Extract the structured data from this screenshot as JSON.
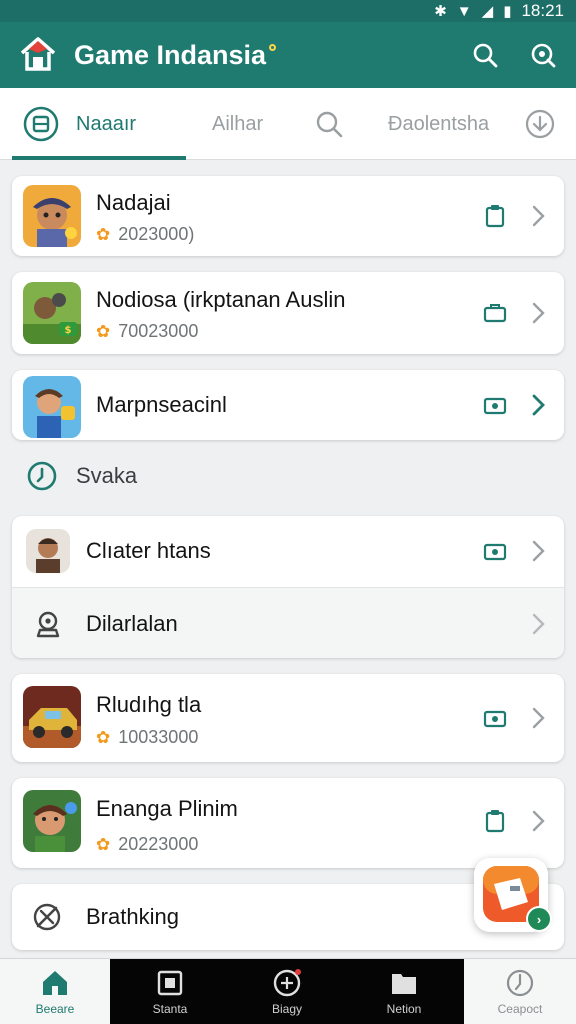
{
  "status_bar": {
    "time": "18:21",
    "icons": [
      "bluetooth-icon",
      "wifi-icon",
      "signal-icon",
      "battery-icon"
    ]
  },
  "app_bar": {
    "title": "Game Indansia",
    "actions": [
      "search-icon",
      "search-alt-icon"
    ]
  },
  "tabs": [
    {
      "label": "Naaaır",
      "icon": "grid-icon",
      "active": true
    },
    {
      "label": "Ailhar",
      "active": false
    },
    {
      "label": "",
      "icon": "search-icon",
      "active": false
    },
    {
      "label": "Ðaolentsha",
      "active": false
    },
    {
      "label": "",
      "icon": "download-icon",
      "active": false
    }
  ],
  "items": [
    {
      "name": "Nadajai",
      "meta": "2023000)"
    },
    {
      "name": "Nodiosa (irkptanan Auslin",
      "meta": "70023000"
    },
    {
      "name": "Marpnseacinl",
      "meta": ""
    }
  ],
  "section": {
    "label": "Svaka",
    "icon": "clock-icon"
  },
  "group": [
    {
      "name": "Clıater htans"
    },
    {
      "name": "Dilarlalan"
    }
  ],
  "items2": [
    {
      "name": "Rludıhg tla",
      "meta": "10033000"
    },
    {
      "name": "Enanga Plinim",
      "meta": "20223000"
    },
    {
      "name": "Brathking"
    }
  ],
  "bottom_nav": [
    {
      "label": "Beeare",
      "icon": "home-icon",
      "active": true
    },
    {
      "label": "Stanta",
      "icon": "puzzle-icon"
    },
    {
      "label": "Biagy",
      "icon": "gamepad-icon"
    },
    {
      "label": "Netion",
      "icon": "folder-icon"
    },
    {
      "label": "Ceapoct",
      "icon": "clock-icon"
    }
  ],
  "colors": {
    "primary": "#1f7a70",
    "accent_star": "#f39a1e",
    "fab_badge": "#1f8a58",
    "background": "#eef0f1"
  }
}
